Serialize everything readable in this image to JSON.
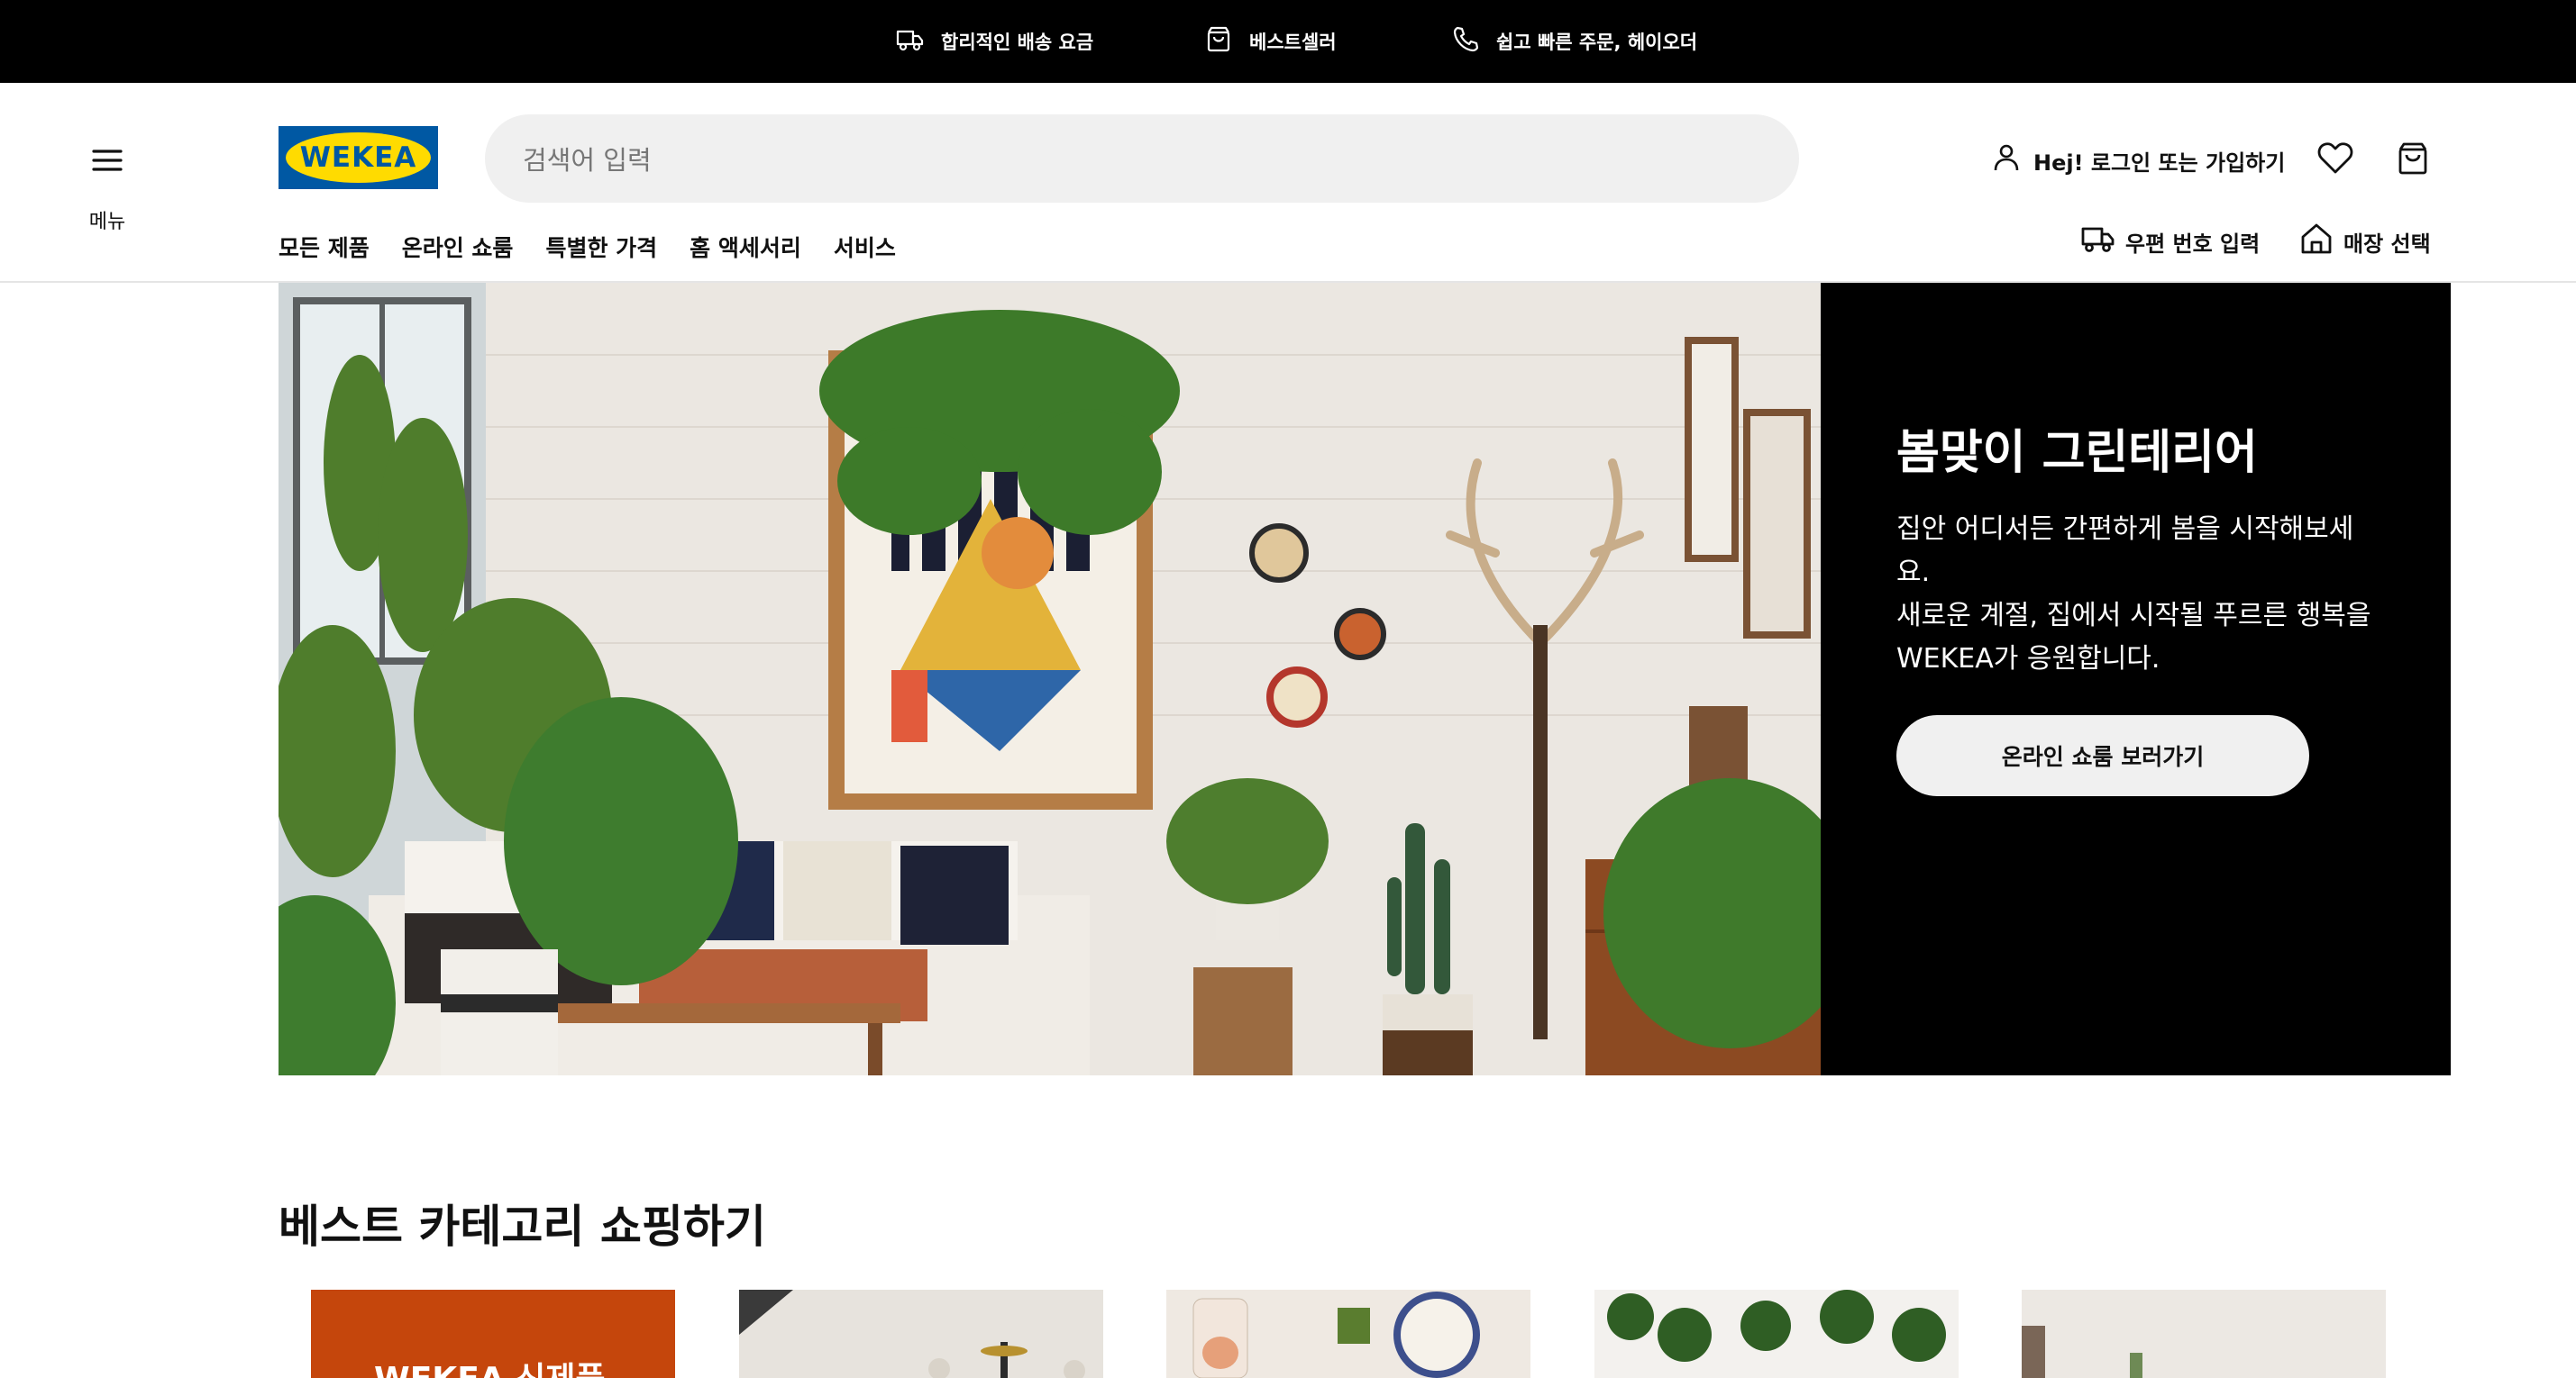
{
  "promo_bar": {
    "items": [
      {
        "icon": "truck-icon",
        "label": "합리적인 배송 요금"
      },
      {
        "icon": "bag-icon",
        "label": "베스트셀러"
      },
      {
        "icon": "phone-icon",
        "label": "쉽고 빠른 주문, 헤이오더"
      }
    ]
  },
  "header": {
    "menu_label": "메뉴",
    "logo_text": "WEKEA",
    "search_placeholder": "검색어 입력",
    "login_label": "Hej! 로그인 또는 가입하기",
    "nav": [
      "모든 제품",
      "온라인 쇼룸",
      "특별한 가격",
      "홈 액세서리",
      "서비스"
    ],
    "postcode_label": "우편 번호 입력",
    "store_label": "매장 선택"
  },
  "hero": {
    "title": "봄맞이 그린테리어",
    "body_line1": "집안 어디서든 간편하게 봄을 시작해보세요.",
    "body_line2": "새로운 계절, 집에서 시작될 푸르른 행복을 WEKEA가 응원합니다.",
    "cta_label": "온라인 쇼룸 보러가기"
  },
  "categories": {
    "title": "베스트 카테고리 쇼핑하기",
    "first_card_label": "WEKEA 신제품"
  },
  "colors": {
    "brand_blue": "#0058a3",
    "brand_yellow": "#ffdb00",
    "promo_bg": "#000000",
    "hero_panel_bg": "#000000",
    "category_orange": "#c5460c"
  }
}
